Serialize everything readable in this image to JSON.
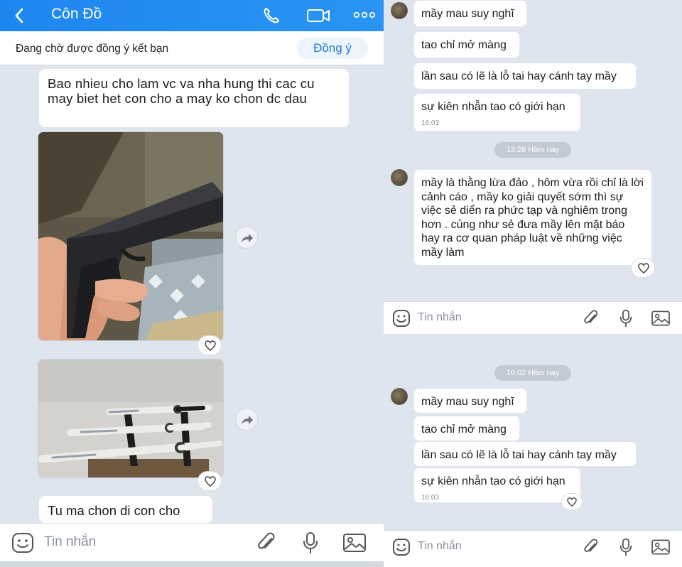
{
  "header": {
    "title": "Côn Đồ"
  },
  "friend_request": {
    "text": "Đang chờ được đồng ý kết bạn",
    "button": "Đồng ý"
  },
  "left_messages": {
    "m1": "Bao nhieu cho lam vc va nha hung thi cac cu may biet het con cho a may ko chon dc dau",
    "m2": "Tu ma chon di con cho"
  },
  "composer": {
    "placeholder": "Tin nhắn"
  },
  "right_top": {
    "m1": "mầy mau suy nghĩ",
    "m2": "tao chỉ mở màng",
    "m3": "lần sau có lẽ là lỗ tai hay cánh tay mầy",
    "m4": "sự kiên nhẫn tao có giới hạn",
    "m4_time": "16:03",
    "chip": "13:28 Hôm nay",
    "m5": "mầy là thằng lừa đảo , hôm vừa rồi chỉ là lời cảnh cáo , mầy ko giải quyết sớm thì sự việc sẻ diển ra phức tạp và nghiêm trong hơn . củng như sẻ đưa mầy lên mặt báo hay ra cơ quan pháp luật về những việc mầy làm"
  },
  "right_bottom": {
    "chip": "16:02 Hôm nay",
    "m1": "mầy mau suy nghĩ",
    "m2": "tao chỉ mở màng",
    "m3": "lần sau có lẽ là lỗ tai hay cánh tay mầy",
    "m4": "sự kiên nhẫn tao có giới hạn",
    "m4_time": "16:03"
  },
  "icons": [
    "back-icon",
    "phone-icon",
    "video-icon",
    "more-icon",
    "heart-icon",
    "share-icon",
    "emoji-icon",
    "paperclip-icon",
    "microphone-icon",
    "image-icon"
  ],
  "colors": {
    "header": "#1e86f0",
    "accent": "#1f7ae0",
    "background": "#dfe5ee"
  }
}
